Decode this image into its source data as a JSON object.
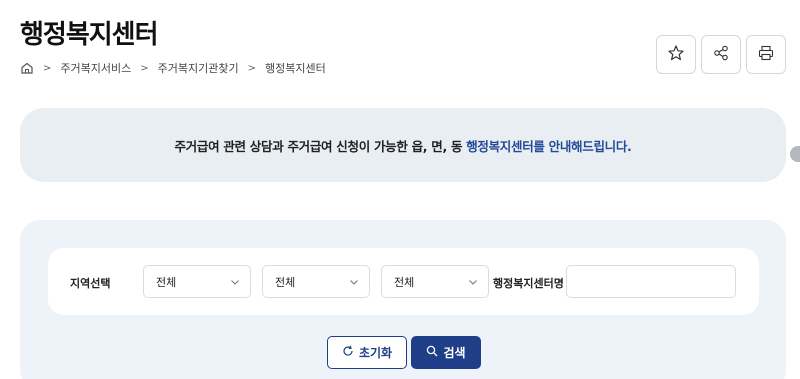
{
  "page": {
    "title": "행정복지센터"
  },
  "breadcrumb": {
    "items": [
      "주거복지서비스",
      "주거복지기관찾기",
      "행정복지센터"
    ],
    "separator": ">"
  },
  "toolbar": {
    "buttons": [
      "star-icon",
      "share-icon",
      "print-icon"
    ]
  },
  "notice": {
    "text": "주거급여 관련 상담과 주거급여 신청이 가능한 읍, 면, 동",
    "highlight": "행정복지센터를 안내해드립니다.",
    "highlight_color": "#234a97"
  },
  "search": {
    "region_label": "지역선택",
    "selects": [
      {
        "value": "전체"
      },
      {
        "value": "전체"
      },
      {
        "value": "전체"
      }
    ],
    "center_label": "행정복지센터명",
    "center_input": {
      "value": "",
      "placeholder": ""
    },
    "reset_label": "초기화",
    "search_label": "검색"
  },
  "colors": {
    "primary": "#1e3f87",
    "notice_bg": "#e9eef3",
    "panel_bg": "#eef3fa"
  }
}
